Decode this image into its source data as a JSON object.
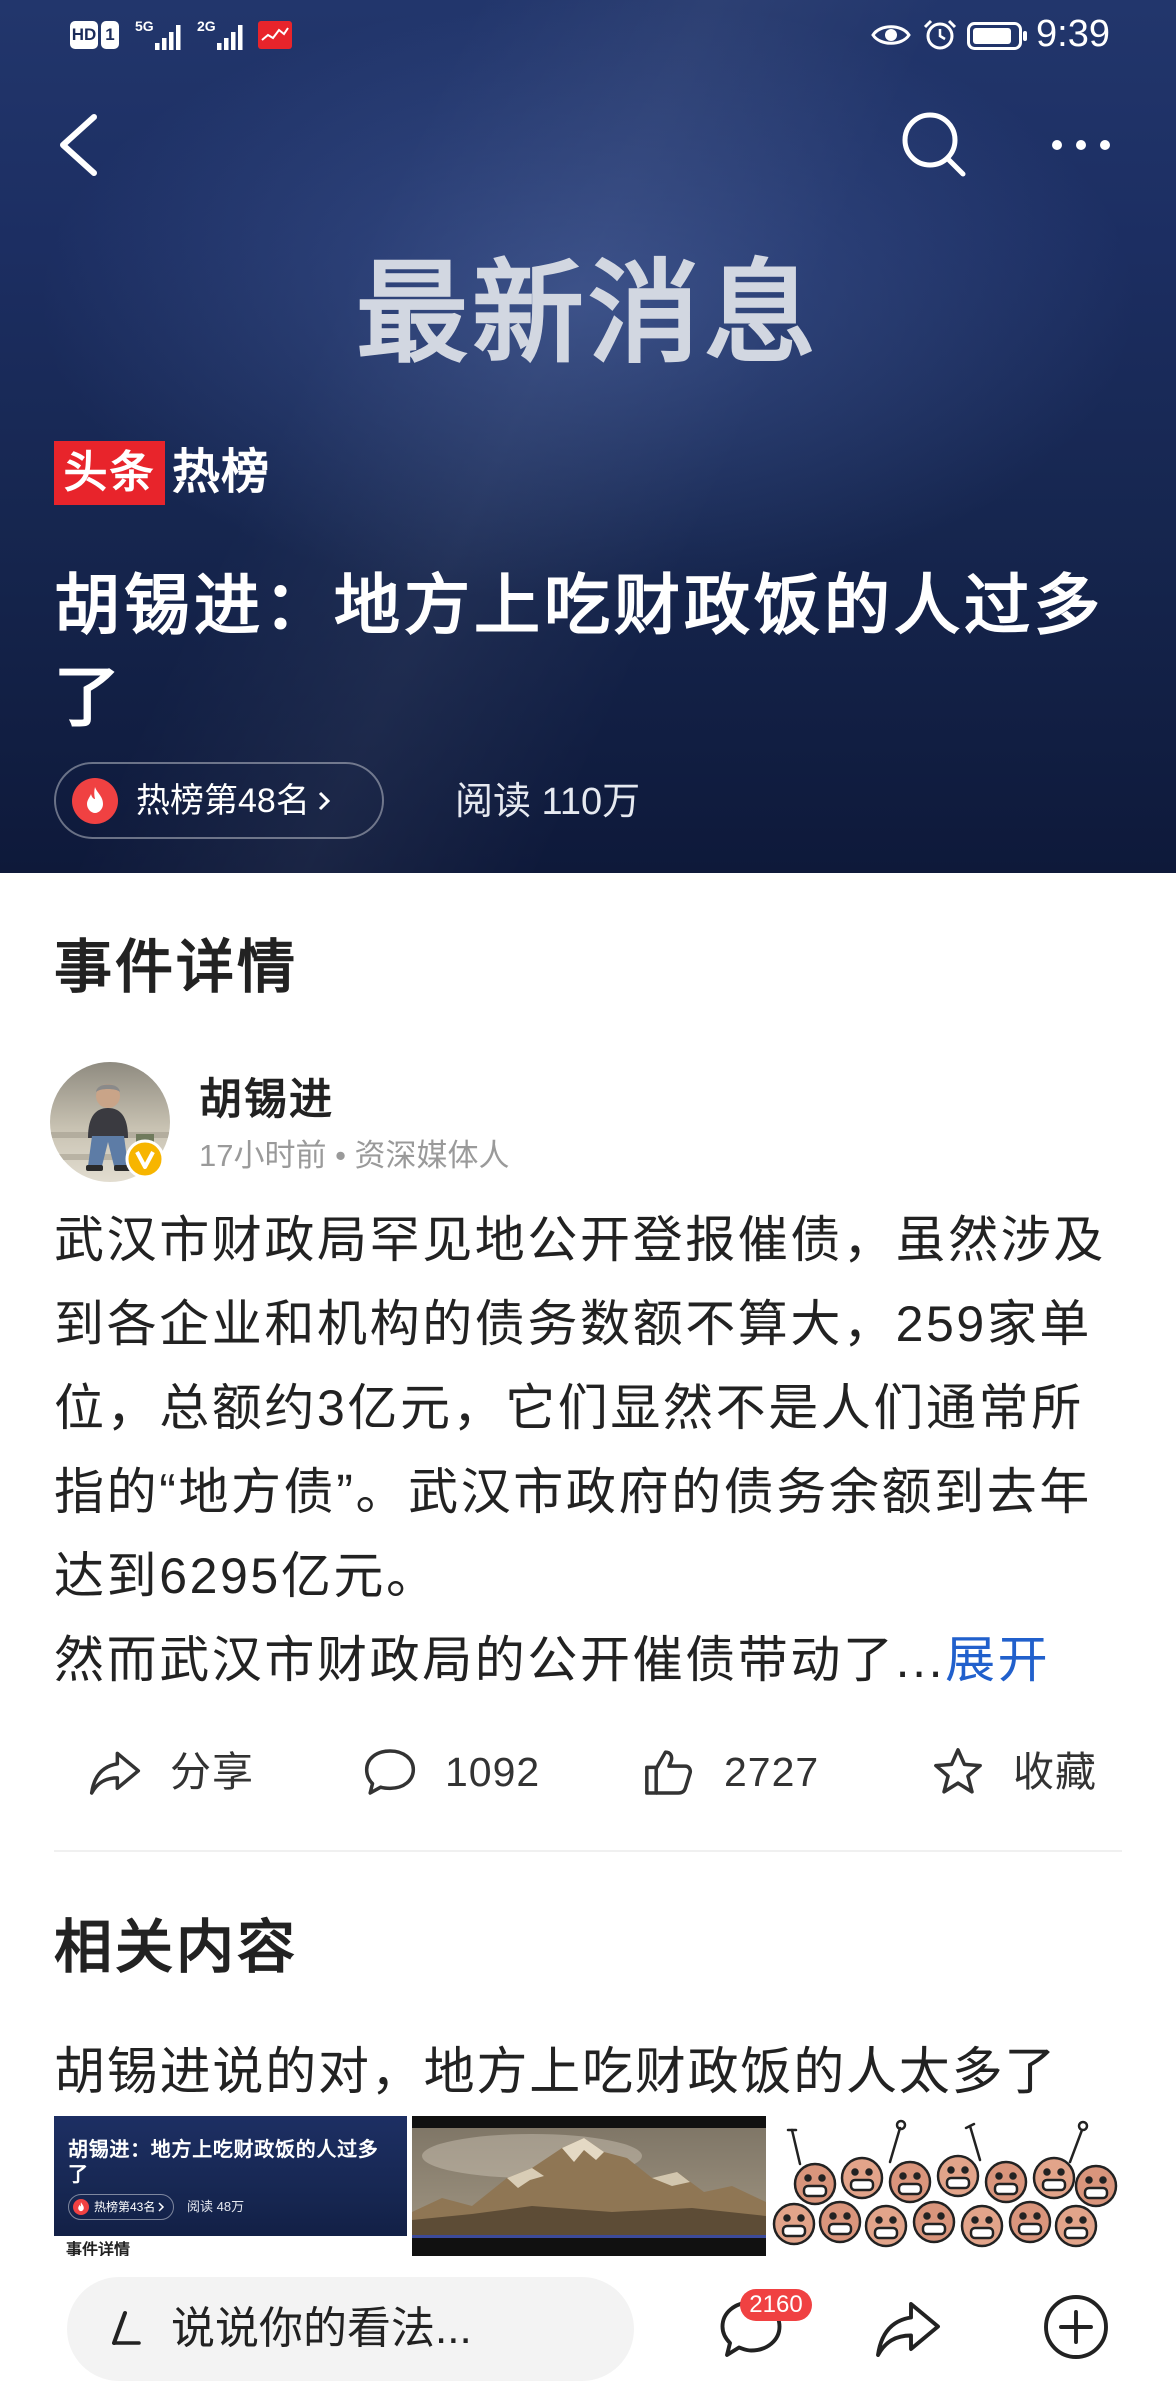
{
  "colors": {
    "header_bg": "#16254f",
    "brand_red": "#e8242b",
    "link_blue": "#2160cc",
    "badge_red": "#f04142",
    "verified_yellow": "#f7b500",
    "text_primary": "#222222",
    "text_secondary": "#9a9a9a"
  },
  "icons": {
    "back": "back-arrow-icon",
    "search": "search-icon",
    "more": "more-dots-icon",
    "rank": "fire-icon",
    "share": "share-icon",
    "comment": "comment-icon",
    "like": "thumbs-up-icon",
    "favorite": "star-icon",
    "write": "pen-icon",
    "add": "add-circle-icon"
  },
  "status_bar": {
    "hd": "HD",
    "sim": "1",
    "net1": "5G",
    "net2": "2G",
    "time": "9:39"
  },
  "header": {
    "banner": "最新消息",
    "brand_red": "头条",
    "brand_white": "热榜",
    "title": "胡锡进：地方上吃财政饭的人过多了",
    "rank": "热榜第48名",
    "reads": "阅读 110万"
  },
  "event": {
    "section_title": "事件详情",
    "author": {
      "name": "胡锡进",
      "meta": "17小时前 • 资深媒体人"
    },
    "lines": [
      "武汉市财政局罕见地公开登报催债，虽然涉及",
      "到各企业和机构的债务数额不算大，259家单",
      "位，总额约3亿元，它们显然不是人们通常所",
      "指的“地方债”。武汉市政府的债务余额到去年",
      "达到6295亿元。"
    ],
    "teaser": "然而武汉市财政局的公开催债带动了...",
    "expand": "展开",
    "actions": {
      "share": "分享",
      "comments": "1092",
      "likes": "2727",
      "favorite": "收藏"
    }
  },
  "related": {
    "section_title": "相关内容",
    "item_title": "胡锡进说的对，地方上吃财政饭的人太多了",
    "thumb1": {
      "title": "胡锡进：地方上吃财政饭的人过多了",
      "rank": "热榜第43名",
      "reads": "阅读 48万",
      "section": "事件详情"
    }
  },
  "bottom_bar": {
    "placeholder": "说说你的看法...",
    "comment_count": "2160"
  }
}
